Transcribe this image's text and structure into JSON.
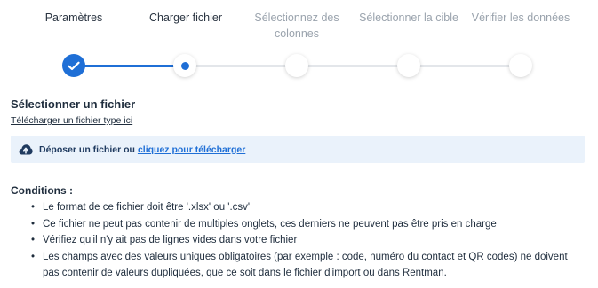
{
  "steps": [
    {
      "label": "Paramètres",
      "state": "done"
    },
    {
      "label": "Charger fichier",
      "state": "current"
    },
    {
      "label": "Sélectionnez des colonnes",
      "state": "pending"
    },
    {
      "label": "Sélectionner la cible",
      "state": "pending"
    },
    {
      "label": "Vérifier les données",
      "state": "pending"
    }
  ],
  "upload": {
    "title": "Sélectionner un fichier",
    "template_link": "Télécharger un fichier type ici",
    "dropzone_text": "Déposer un fichier ou",
    "dropzone_link": "cliquez pour télécharger"
  },
  "conditions": {
    "title": "Conditions :",
    "items": [
      "Le format de ce fichier doit être '.xlsx' ou '.csv'",
      "Ce fichier ne peut pas contenir de multiples onglets, ces derniers ne peuvent pas être pris en charge",
      "Vérifiez qu'il n'y ait pas de lignes vides dans votre fichier",
      "Les champs avec des valeurs uniques obligatoires (par exemple : code, numéro du contact et QR codes) ne doivent pas contenir de valeurs dupliquées, que ce soit dans le fichier d'import ou dans Rentman."
    ]
  },
  "colors": {
    "accent": "#1f6fd6",
    "dropzone_bg": "#eaf2fb",
    "muted": "#9aa3ad"
  },
  "icons": {
    "done_step": "check-icon",
    "upload": "cloud-upload-icon"
  }
}
